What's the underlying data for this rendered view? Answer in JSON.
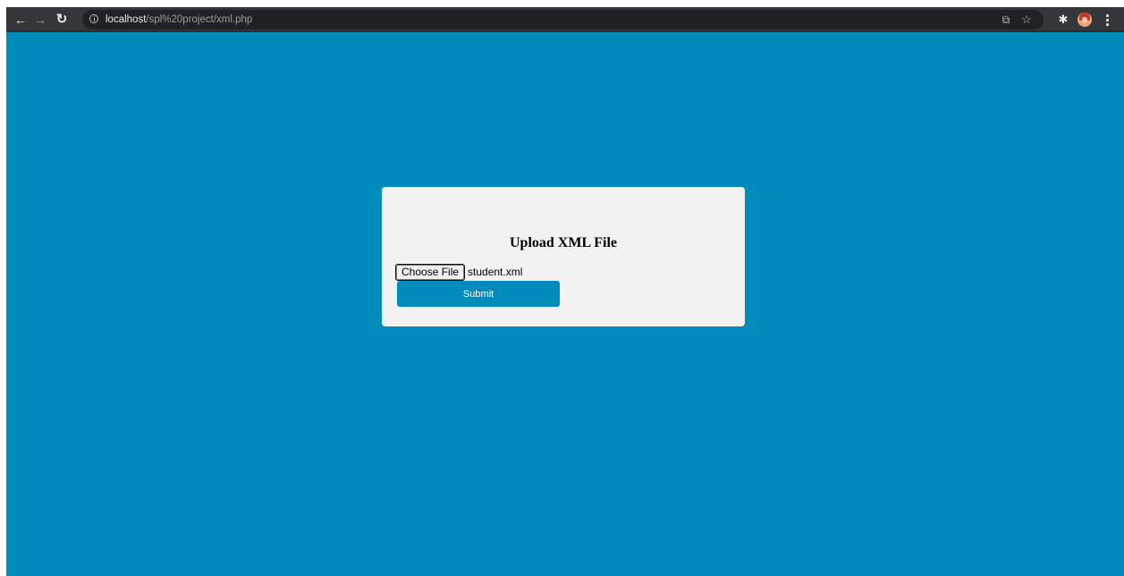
{
  "browser": {
    "url_host": "localhost",
    "url_path": "/spl%20project/xml.php",
    "icons": {
      "back": "arrow-left-icon",
      "forward": "arrow-right-icon",
      "reload": "reload-icon",
      "site_info": "info-icon",
      "share": "share-icon",
      "bookmark": "star-icon",
      "extensions": "puzzle-icon",
      "profile": "avatar",
      "menu": "kebab-menu-icon"
    }
  },
  "page": {
    "background_color": "#008bbd",
    "card": {
      "title": "Upload XML File",
      "file_input": {
        "button_label": "Choose File",
        "selected_file": "student.xml"
      },
      "submit_label": "Submit",
      "accent_color": "#008bbd"
    }
  }
}
